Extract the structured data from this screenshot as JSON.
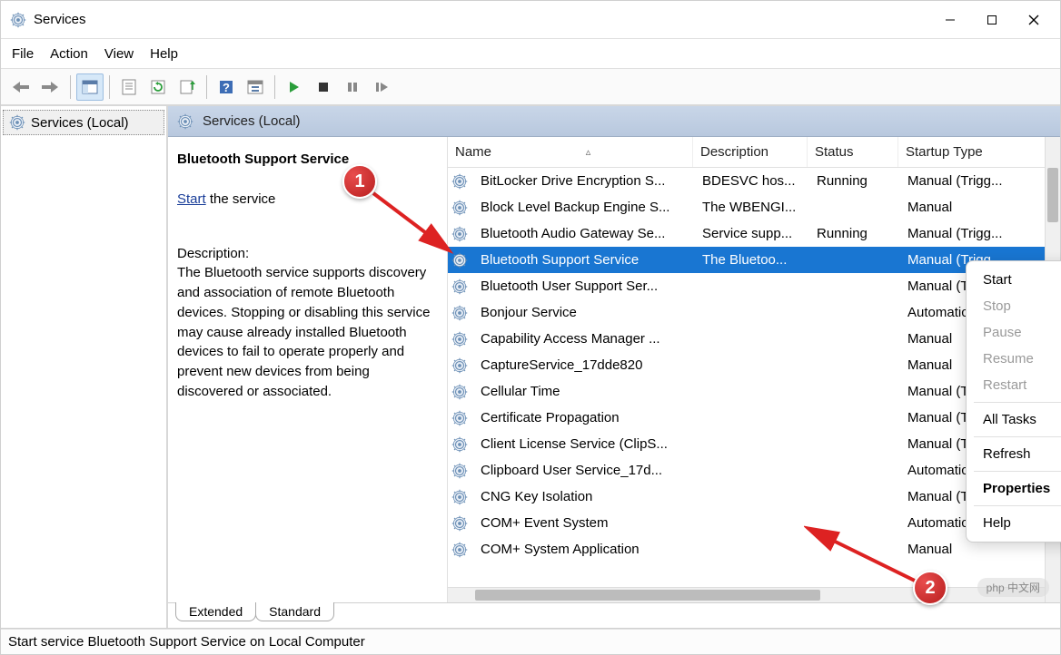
{
  "window": {
    "title": "Services"
  },
  "menu": {
    "file": "File",
    "action": "Action",
    "view": "View",
    "help": "Help"
  },
  "tree": {
    "root": "Services (Local)"
  },
  "header": {
    "label": "Services (Local)"
  },
  "detail": {
    "service_name": "Bluetooth Support Service",
    "start_link": "Start",
    "start_suffix": " the service",
    "desc_label": "Description:",
    "description": "The Bluetooth service supports discovery and association of remote Bluetooth devices.  Stopping or disabling this service may cause already installed Bluetooth devices to fail to operate properly and prevent new devices from being discovered or associated."
  },
  "columns": {
    "name": "Name",
    "description": "Description",
    "status": "Status",
    "startup": "Startup Type"
  },
  "services": [
    {
      "name": "BitLocker Drive Encryption S...",
      "desc": "BDESVC hos...",
      "status": "Running",
      "startup": "Manual (Trigg..."
    },
    {
      "name": "Block Level Backup Engine S...",
      "desc": "The WBENGI...",
      "status": "",
      "startup": "Manual"
    },
    {
      "name": "Bluetooth Audio Gateway Se...",
      "desc": "Service supp...",
      "status": "Running",
      "startup": "Manual (Trigg..."
    },
    {
      "name": "Bluetooth Support Service",
      "desc": "The Bluetoo...",
      "status": "",
      "startup": "Manual (Trigg...",
      "selected": true
    },
    {
      "name": "Bluetooth User Support Ser...",
      "desc": "",
      "status": "",
      "startup": "Manual (Trigg..."
    },
    {
      "name": "Bonjour Service",
      "desc": "",
      "status": "",
      "startup": "Automatic"
    },
    {
      "name": "Capability Access Manager ...",
      "desc": "",
      "status": "",
      "startup": "Manual"
    },
    {
      "name": "CaptureService_17dde820",
      "desc": "",
      "status": "",
      "startup": "Manual"
    },
    {
      "name": "Cellular Time",
      "desc": "",
      "status": "",
      "startup": "Manual (Trigg..."
    },
    {
      "name": "Certificate Propagation",
      "desc": "",
      "status": "",
      "startup": "Manual (Trigg..."
    },
    {
      "name": "Client License Service (ClipS...",
      "desc": "",
      "status": "",
      "startup": "Manual (Trigg..."
    },
    {
      "name": "Clipboard User Service_17d...",
      "desc": "",
      "status": "",
      "startup": "Automatic (De..."
    },
    {
      "name": "CNG Key Isolation",
      "desc": "",
      "status": "",
      "startup": "Manual (Trigg..."
    },
    {
      "name": "COM+ Event System",
      "desc": "",
      "status": "",
      "startup": "Automatic"
    },
    {
      "name": "COM+ System Application",
      "desc": "",
      "status": "",
      "startup": "Manual"
    }
  ],
  "context_menu": {
    "start": "Start",
    "stop": "Stop",
    "pause": "Pause",
    "resume": "Resume",
    "restart": "Restart",
    "all_tasks": "All Tasks",
    "refresh": "Refresh",
    "properties": "Properties",
    "help": "Help"
  },
  "tabs": {
    "extended": "Extended",
    "standard": "Standard"
  },
  "status_bar": "Start service Bluetooth Support Service on Local Computer",
  "annotations": {
    "badge1": "1",
    "badge2": "2"
  },
  "watermark": "php 中文网"
}
